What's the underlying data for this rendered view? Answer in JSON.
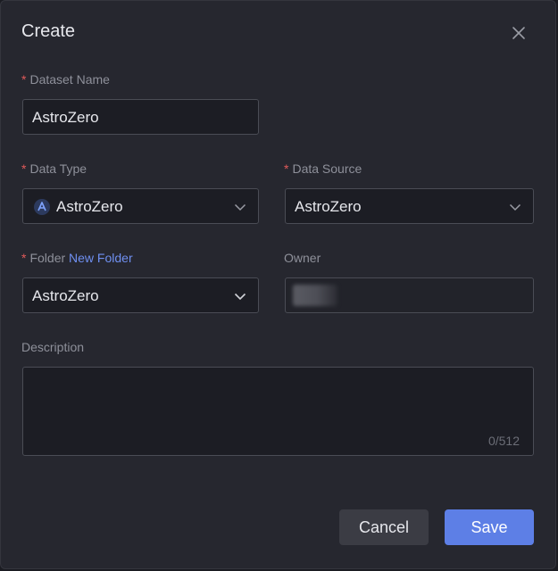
{
  "dialog": {
    "title": "Create",
    "close_icon": "close-icon"
  },
  "dataset_name": {
    "required_mark": "*",
    "label": "Dataset Name",
    "value": "AstroZero"
  },
  "data_type": {
    "required_mark": "*",
    "label": "Data Type",
    "value": "AstroZero",
    "icon": "astrozero-logo-icon"
  },
  "data_source": {
    "required_mark": "*",
    "label": "Data Source",
    "value": "AstroZero"
  },
  "folder": {
    "required_mark": "*",
    "label": "Folder",
    "new_folder_link": "New Folder",
    "value": "AstroZero"
  },
  "owner": {
    "label": "Owner"
  },
  "description": {
    "label": "Description",
    "value": "",
    "counter": "0/512"
  },
  "footer": {
    "cancel_label": "Cancel",
    "save_label": "Save"
  },
  "colors": {
    "dialog_bg": "#26272f",
    "field_bg": "#1c1d24",
    "border": "#4a4c55",
    "required": "#e05a5a",
    "link": "#6f8ff0",
    "primary": "#5d7fe6"
  }
}
